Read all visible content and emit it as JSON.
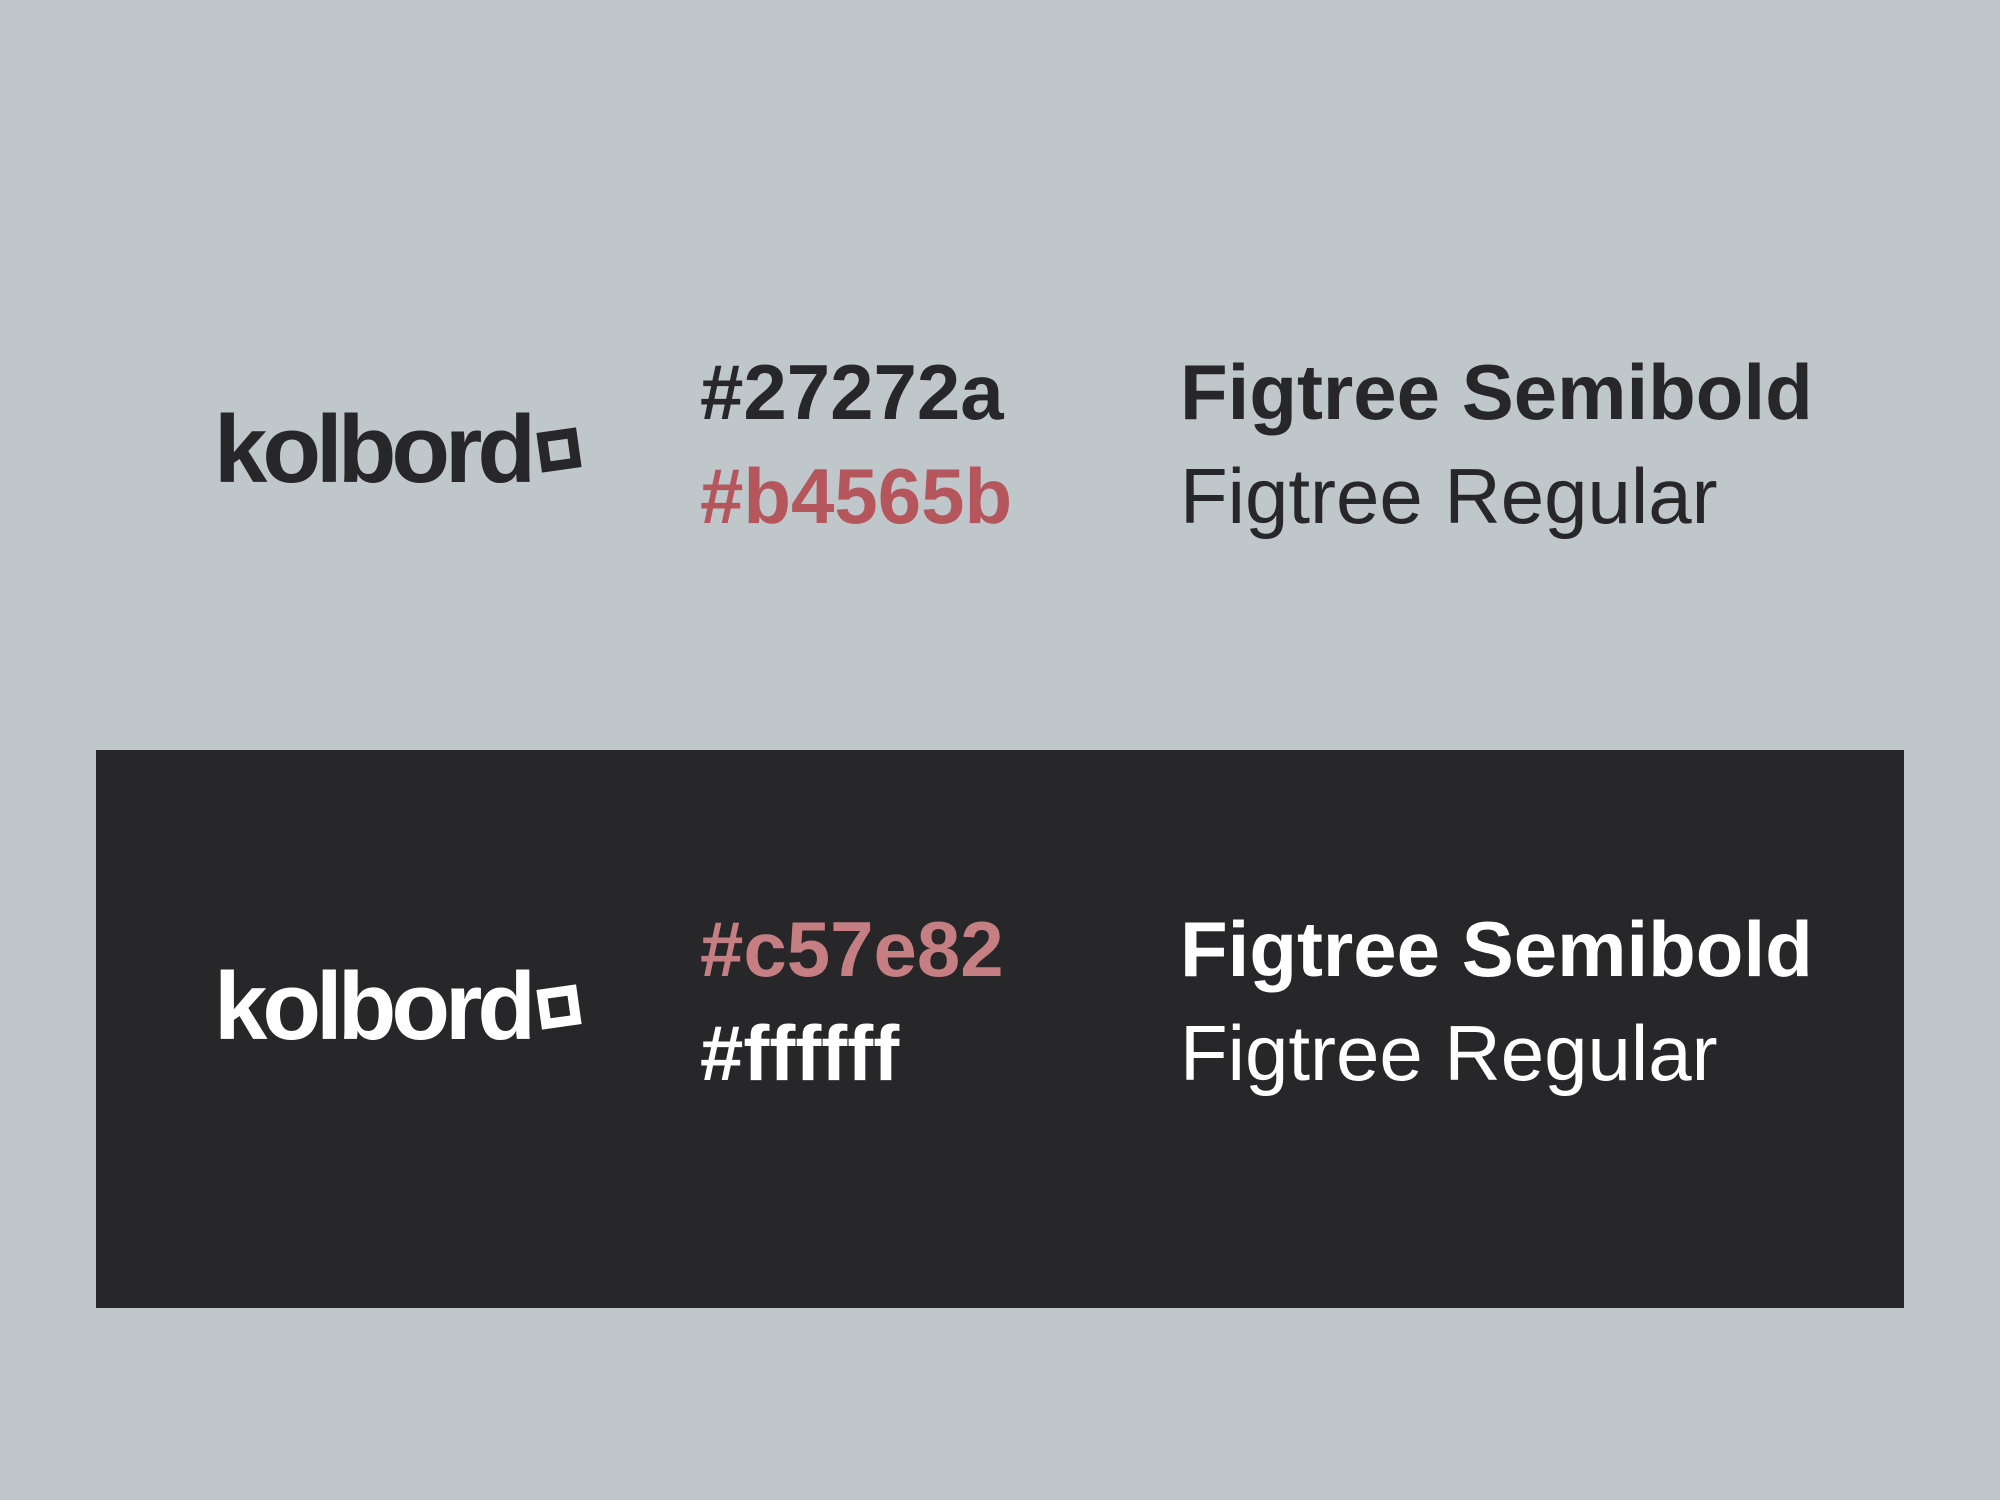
{
  "light": {
    "logo_text": "kolbord",
    "colors": [
      {
        "label": "#27272a",
        "color": "#27272a"
      },
      {
        "label": "#b4565b",
        "color": "#b4565b"
      }
    ],
    "fonts": {
      "semibold": "Figtree Semibold",
      "regular": "Figtree Regular"
    }
  },
  "dark": {
    "logo_text": "kolbord",
    "colors": [
      {
        "label": "#c57e82",
        "color": "#c57e82"
      },
      {
        "label": "#ffffff",
        "color": "#ffffff"
      }
    ],
    "fonts": {
      "semibold": "Figtree Semibold",
      "regular": "Figtree Regular"
    }
  },
  "theme": {
    "background": "#bfc7ca",
    "dark_panel": "#27272a"
  }
}
